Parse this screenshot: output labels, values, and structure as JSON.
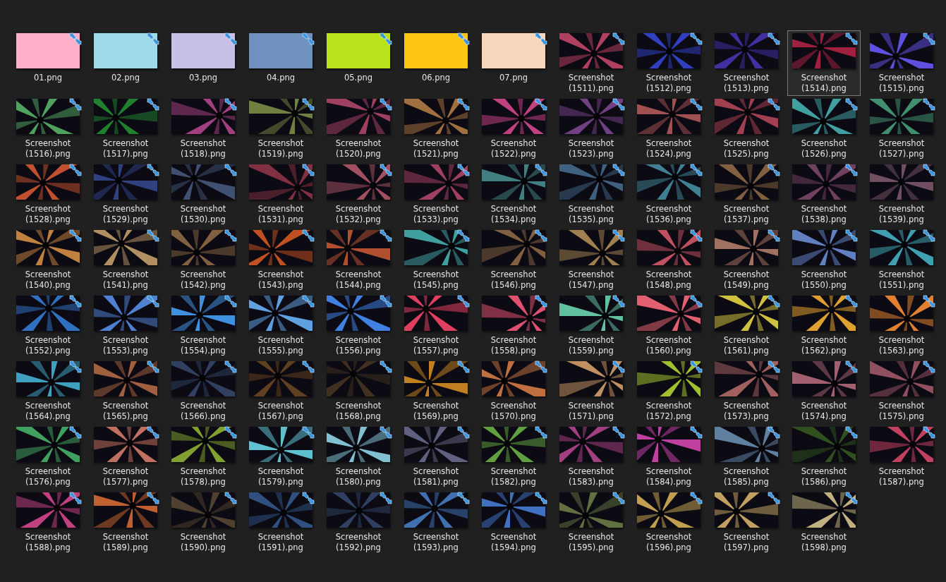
{
  "files": [
    {
      "name": "01.png",
      "kind": "swatch",
      "color": "#ffb0c8",
      "selected": false
    },
    {
      "name": "02.png",
      "kind": "swatch",
      "color": "#9ddbea",
      "selected": false
    },
    {
      "name": "03.png",
      "kind": "swatch",
      "color": "#c8c0e6",
      "selected": false
    },
    {
      "name": "04.png",
      "kind": "swatch",
      "color": "#6f91bf",
      "selected": false
    },
    {
      "name": "05.png",
      "kind": "swatch",
      "color": "#b8e31c",
      "selected": false
    },
    {
      "name": "06.png",
      "kind": "swatch",
      "color": "#fec614",
      "selected": false
    },
    {
      "name": "07.png",
      "kind": "swatch",
      "color": "#f8d6bc",
      "selected": false
    },
    {
      "name": "Screenshot (1511).png",
      "kind": "picture",
      "color": "#b04060",
      "selected": false
    },
    {
      "name": "Screenshot (1512).png",
      "kind": "picture",
      "color": "#3040c0",
      "selected": false
    },
    {
      "name": "Screenshot (1513).png",
      "kind": "picture",
      "color": "#4030a0",
      "selected": false
    },
    {
      "name": "Screenshot (1514).png",
      "kind": "picture",
      "color": "#a02040",
      "selected": true
    },
    {
      "name": "Screenshot (1515).png",
      "kind": "picture",
      "color": "#6050e0",
      "selected": false
    },
    {
      "name": "Screenshot (1516).png",
      "kind": "picture",
      "color": "#50a060",
      "selected": false
    },
    {
      "name": "Screenshot (1517).png",
      "kind": "picture",
      "color": "#208030",
      "selected": false
    },
    {
      "name": "Screenshot (1518).png",
      "kind": "picture",
      "color": "#a04080",
      "selected": false
    },
    {
      "name": "Screenshot (1519).png",
      "kind": "picture",
      "color": "#708040",
      "selected": false
    },
    {
      "name": "Screenshot (1520).png",
      "kind": "picture",
      "color": "#a04060",
      "selected": false
    },
    {
      "name": "Screenshot (1521).png",
      "kind": "picture",
      "color": "#a07040",
      "selected": false
    },
    {
      "name": "Screenshot (1522).png",
      "kind": "picture",
      "color": "#c04080",
      "selected": false
    },
    {
      "name": "Screenshot (1523).png",
      "kind": "picture",
      "color": "#704080",
      "selected": false
    },
    {
      "name": "Screenshot (1524).png",
      "kind": "picture",
      "color": "#a05050",
      "selected": false
    },
    {
      "name": "Screenshot (1525).png",
      "kind": "picture",
      "color": "#a04050",
      "selected": false
    },
    {
      "name": "Screenshot (1526).png",
      "kind": "picture",
      "color": "#40a0a0",
      "selected": false
    },
    {
      "name": "Screenshot (1527).png",
      "kind": "picture",
      "color": "#409070",
      "selected": false
    },
    {
      "name": "Screenshot (1528).png",
      "kind": "picture",
      "color": "#c05030",
      "selected": false
    },
    {
      "name": "Screenshot (1529).png",
      "kind": "picture",
      "color": "#304080",
      "selected": false
    },
    {
      "name": "Screenshot (1530).png",
      "kind": "picture",
      "color": "#405070",
      "selected": false
    },
    {
      "name": "Screenshot (1531).png",
      "kind": "picture",
      "color": "#803040",
      "selected": false
    },
    {
      "name": "Screenshot (1532).png",
      "kind": "picture",
      "color": "#a05060",
      "selected": false
    },
    {
      "name": "Screenshot (1533).png",
      "kind": "picture",
      "color": "#a04060",
      "selected": false
    },
    {
      "name": "Screenshot (1534).png",
      "kind": "picture",
      "color": "#408080",
      "selected": false
    },
    {
      "name": "Screenshot (1535).png",
      "kind": "picture",
      "color": "#406080",
      "selected": false
    },
    {
      "name": "Screenshot (1536).png",
      "kind": "picture",
      "color": "#408090",
      "selected": false
    },
    {
      "name": "Screenshot (1537).png",
      "kind": "picture",
      "color": "#806040",
      "selected": false
    },
    {
      "name": "Screenshot (1538).png",
      "kind": "picture",
      "color": "#704060",
      "selected": false
    },
    {
      "name": "Screenshot (1539).png",
      "kind": "picture",
      "color": "#705060",
      "selected": false
    },
    {
      "name": "Screenshot (1540).png",
      "kind": "picture",
      "color": "#c08040",
      "selected": false
    },
    {
      "name": "Screenshot (1541).png",
      "kind": "picture",
      "color": "#b09060",
      "selected": false
    },
    {
      "name": "Screenshot (1542).png",
      "kind": "picture",
      "color": "#806040",
      "selected": false
    },
    {
      "name": "Screenshot (1543).png",
      "kind": "picture",
      "color": "#c05020",
      "selected": false
    },
    {
      "name": "Screenshot (1544).png",
      "kind": "picture",
      "color": "#b05030",
      "selected": false
    },
    {
      "name": "Screenshot (1545).png",
      "kind": "picture",
      "color": "#40a0a0",
      "selected": false
    },
    {
      "name": "Screenshot (1546).png",
      "kind": "picture",
      "color": "#806040",
      "selected": false
    },
    {
      "name": "Screenshot (1547).png",
      "kind": "picture",
      "color": "#a08050",
      "selected": false
    },
    {
      "name": "Screenshot (1548).png",
      "kind": "picture",
      "color": "#c05060",
      "selected": false
    },
    {
      "name": "Screenshot (1549).png",
      "kind": "picture",
      "color": "#a07060",
      "selected": false
    },
    {
      "name": "Screenshot (1550).png",
      "kind": "picture",
      "color": "#6080c0",
      "selected": false
    },
    {
      "name": "Screenshot (1551).png",
      "kind": "picture",
      "color": "#40a0b0",
      "selected": false
    },
    {
      "name": "Screenshot (1552).png",
      "kind": "picture",
      "color": "#3070c0",
      "selected": false
    },
    {
      "name": "Screenshot (1553).png",
      "kind": "picture",
      "color": "#5080d0",
      "selected": false
    },
    {
      "name": "Screenshot (1554).png",
      "kind": "picture",
      "color": "#4090e0",
      "selected": false
    },
    {
      "name": "Screenshot (1555).png",
      "kind": "picture",
      "color": "#60a0e0",
      "selected": false
    },
    {
      "name": "Screenshot (1556).png",
      "kind": "picture",
      "color": "#4080e0",
      "selected": false
    },
    {
      "name": "Screenshot (1557).png",
      "kind": "picture",
      "color": "#e04060",
      "selected": false
    },
    {
      "name": "Screenshot (1558).png",
      "kind": "picture",
      "color": "#e05070",
      "selected": false
    },
    {
      "name": "Screenshot (1559).png",
      "kind": "picture",
      "color": "#60c0a0",
      "selected": false
    },
    {
      "name": "Screenshot (1560).png",
      "kind": "picture",
      "color": "#e06070",
      "selected": false
    },
    {
      "name": "Screenshot (1561).png",
      "kind": "picture",
      "color": "#d0c040",
      "selected": false
    },
    {
      "name": "Screenshot (1562).png",
      "kind": "picture",
      "color": "#e0a030",
      "selected": false
    },
    {
      "name": "Screenshot (1563).png",
      "kind": "picture",
      "color": "#e08030",
      "selected": false
    },
    {
      "name": "Screenshot (1564).png",
      "kind": "picture",
      "color": "#40a0c0",
      "selected": false
    },
    {
      "name": "Screenshot (1565).png",
      "kind": "picture",
      "color": "#a06040",
      "selected": false
    },
    {
      "name": "Screenshot (1566).png",
      "kind": "picture",
      "color": "#304060",
      "selected": false
    },
    {
      "name": "Screenshot (1567).png",
      "kind": "picture",
      "color": "#604020",
      "selected": false
    },
    {
      "name": "Screenshot (1568).png",
      "kind": "picture",
      "color": "#403020",
      "selected": false
    },
    {
      "name": "Screenshot (1569).png",
      "kind": "picture",
      "color": "#c08020",
      "selected": false
    },
    {
      "name": "Screenshot (1570).png",
      "kind": "picture",
      "color": "#c07040",
      "selected": false
    },
    {
      "name": "Screenshot (1571).png",
      "kind": "picture",
      "color": "#c09060",
      "selected": false
    },
    {
      "name": "Screenshot (1572).png",
      "kind": "picture",
      "color": "#a0c030",
      "selected": false
    },
    {
      "name": "Screenshot (1573).png",
      "kind": "picture",
      "color": "#a06060",
      "selected": false
    },
    {
      "name": "Screenshot (1574).png",
      "kind": "picture",
      "color": "#a06070",
      "selected": false
    },
    {
      "name": "Screenshot (1575).png",
      "kind": "picture",
      "color": "#905060",
      "selected": false
    },
    {
      "name": "Screenshot (1576).png",
      "kind": "picture",
      "color": "#40a060",
      "selected": false
    },
    {
      "name": "Screenshot (1577).png",
      "kind": "picture",
      "color": "#c07060",
      "selected": false
    },
    {
      "name": "Screenshot (1578).png",
      "kind": "picture",
      "color": "#80a030",
      "selected": false
    },
    {
      "name": "Screenshot (1579).png",
      "kind": "picture",
      "color": "#60c0d0",
      "selected": false
    },
    {
      "name": "Screenshot (1580).png",
      "kind": "picture",
      "color": "#80c0d0",
      "selected": false
    },
    {
      "name": "Screenshot (1581).png",
      "kind": "picture",
      "color": "#606080",
      "selected": false
    },
    {
      "name": "Screenshot (1582).png",
      "kind": "picture",
      "color": "#60a040",
      "selected": false
    },
    {
      "name": "Screenshot (1583).png",
      "kind": "picture",
      "color": "#a04080",
      "selected": false
    },
    {
      "name": "Screenshot (1584).png",
      "kind": "picture",
      "color": "#c040a0",
      "selected": false
    },
    {
      "name": "Screenshot (1585).png",
      "kind": "picture",
      "color": "#6080a0",
      "selected": false
    },
    {
      "name": "Screenshot (1586).png",
      "kind": "picture",
      "color": "#305020",
      "selected": false
    },
    {
      "name": "Screenshot (1587).png",
      "kind": "picture",
      "color": "#c04060",
      "selected": false
    },
    {
      "name": "Screenshot (1588).png",
      "kind": "picture",
      "color": "#c04080",
      "selected": false
    },
    {
      "name": "Screenshot (1589).png",
      "kind": "picture",
      "color": "#c06030",
      "selected": false
    },
    {
      "name": "Screenshot (1590).png",
      "kind": "picture",
      "color": "#504030",
      "selected": false
    },
    {
      "name": "Screenshot (1591).png",
      "kind": "picture",
      "color": "#305080",
      "selected": false
    },
    {
      "name": "Screenshot (1592).png",
      "kind": "picture",
      "color": "#304060",
      "selected": false
    },
    {
      "name": "Screenshot (1593).png",
      "kind": "picture",
      "color": "#4070b0",
      "selected": false
    },
    {
      "name": "Screenshot (1594).png",
      "kind": "picture",
      "color": "#4070c0",
      "selected": false
    },
    {
      "name": "Screenshot (1595).png",
      "kind": "picture",
      "color": "#607040",
      "selected": false
    },
    {
      "name": "Screenshot (1596).png",
      "kind": "picture",
      "color": "#c0a050",
      "selected": false
    },
    {
      "name": "Screenshot (1597).png",
      "kind": "picture",
      "color": "#c0a060",
      "selected": false
    },
    {
      "name": "Screenshot (1598).png",
      "kind": "picture",
      "color": "#c0b080",
      "selected": false
    }
  ]
}
